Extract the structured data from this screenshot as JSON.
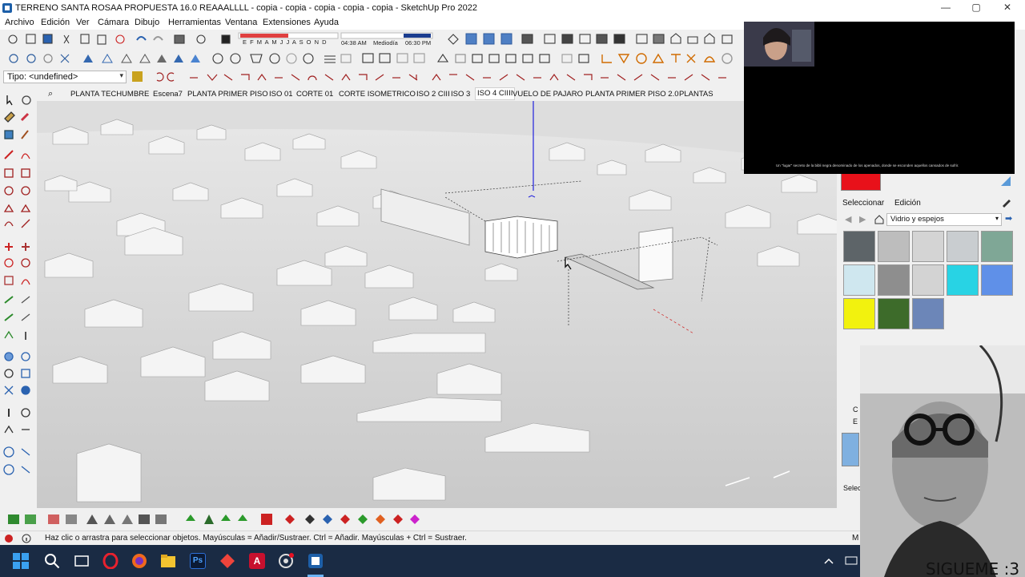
{
  "window": {
    "title": "TERRENO SANTA ROSAA PROPUESTA 16.0 REAAALLLL - copia - copia - copia - copia - copia - SketchUp Pro 2022",
    "minimize": "—",
    "maximize": "▢",
    "close": "✕"
  },
  "menu": [
    "Archivo",
    "Edición",
    "Ver",
    "Cámara",
    "Dibujo",
    "Herramientas",
    "Ventana",
    "Extensiones",
    "Ayuda"
  ],
  "shadow": {
    "months": "E F M A M J J A S O N D",
    "time_start": "04:38 AM",
    "time_mid": "Mediodía",
    "time_end": "06:30 PM"
  },
  "tipo": {
    "value": "Tipo: <undefined>",
    "chevron": "▾"
  },
  "scenes": {
    "search_icon": "⌕",
    "items": [
      "PLANTA TECHUMBRE",
      "Escena7",
      "PLANTA PRIMER PISO",
      "ISO 01",
      "CORTE 01",
      "CORTE ISOMETRICO",
      "ISO 2 CIII",
      "ISO 3",
      "ISO 4 CIIII",
      "VUELO DE PAJARO",
      "PLANTA PRIMER PISO 2.0",
      "PLANTAS"
    ],
    "active_index": 8
  },
  "materials": {
    "tab_select": "Seleccionar",
    "tab_edit": "Edición",
    "library": "Vidrio y espejos",
    "chevron": "▾",
    "current_color": "#e8111a",
    "swatch_colors": [
      "#5d6468",
      "#bdbdbd",
      "#d4d4d4",
      "#c9cdd0",
      "#7fa796",
      "#cfe7ef",
      "#8e8e8e",
      "#d3d3d3",
      "#28d3e4",
      "#5f90e8",
      "#f2f20e",
      "#3d6b2a",
      "#6c86b8"
    ],
    "collapsed_1": "C",
    "collapsed_2": "E",
    "select_label": "Selec"
  },
  "camera_overlay": {
    "caption": "Un \"lugar\" secreto de la bibli negra denominado de los apenados, donde se esconden aquellos cansados de sufrir."
  },
  "portrait": {
    "caption": "SIGUEME :3"
  },
  "status": {
    "message": "Haz clic o arrastra para seleccionar objetos. Mayúsculas = Añadir/Sustraer. Ctrl = Añadir. Mayúsculas + Ctrl = Sustraer.",
    "measure_label": "M"
  },
  "taskbar": {
    "items": [
      "windows-start",
      "search",
      "task-view",
      "opera",
      "firefox",
      "file-explorer",
      "photoshop",
      "anydesk",
      "autocad",
      "chrome",
      "sketchup"
    ],
    "photoshop_label": "Ps",
    "autocad_label": "A"
  }
}
